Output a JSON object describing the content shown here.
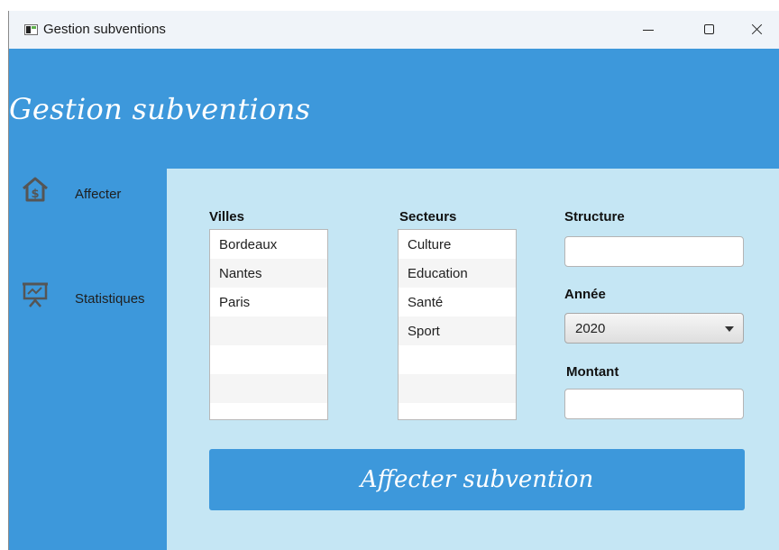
{
  "window": {
    "title": "Gestion subventions"
  },
  "app": {
    "title": "Gestion subventions"
  },
  "nav": {
    "items": [
      {
        "label": "Affecter",
        "icon": "house-dollar-icon"
      },
      {
        "label": "Statistiques",
        "icon": "presentation-chart-icon"
      }
    ]
  },
  "form": {
    "villes_label": "Villes",
    "villes": [
      "Bordeaux",
      "Nantes",
      "Paris"
    ],
    "secteurs_label": "Secteurs",
    "secteurs": [
      "Culture",
      "Education",
      "Santé",
      "Sport"
    ],
    "structure_label": "Structure",
    "structure_value": "",
    "annee_label": "Année",
    "annee_value": "2020",
    "montant_label": "Montant",
    "montant_value": "",
    "submit_label": "Affecter subvention"
  },
  "colors": {
    "primary": "#3d98db",
    "content_bg": "#c5e6f4",
    "titlebar_bg": "#f0f4f9"
  }
}
